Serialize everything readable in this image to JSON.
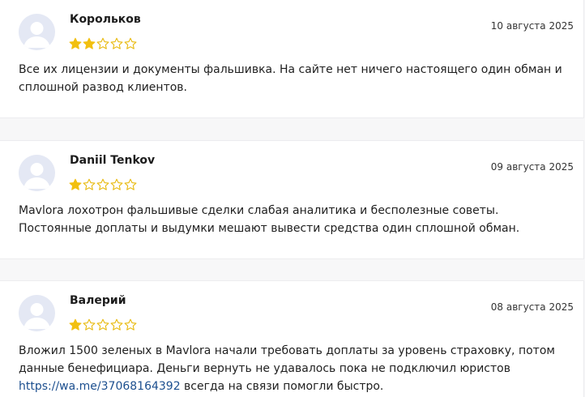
{
  "reviews": [
    {
      "author": "Корольков",
      "date": "10 августа 2025",
      "rating": 2,
      "max_rating": 5,
      "text": "Все их лицензии и документы фальшивка. На сайте нет ничего настоящего один обман и сплошной развод клиентов."
    },
    {
      "author": "Daniil Tenkov",
      "date": "09 августа 2025",
      "rating": 1,
      "max_rating": 5,
      "text": "Mavlora лохотрон фальшивые сделки слабая аналитика и бесполезные советы. Постоянные доплаты и выдумки мешают вывести средства один сплошной обман."
    },
    {
      "author": "Валерий",
      "date": "08 августа 2025",
      "rating": 1,
      "max_rating": 5,
      "text": "Вложил 1500 зеленых в Mavlora начали требовать доплаты за уровень страховку, потом данные бенефициара. Деньги вернуть не удавалось пока не подключил юристов ",
      "link": "https://wa.me/37068164392",
      "text_after_link": " всегда на связи помогли быстро."
    }
  ],
  "colors": {
    "star_filled": "#f2c010",
    "star_empty_outline": "#e8b90c",
    "avatar_bg": "#e4e8f4",
    "avatar_fg": "#ffffff",
    "link": "#1c4f8f"
  },
  "icons": {
    "avatar": "user-silhouette-icon",
    "star_filled": "star-filled-icon",
    "star_empty": "star-outline-icon"
  }
}
